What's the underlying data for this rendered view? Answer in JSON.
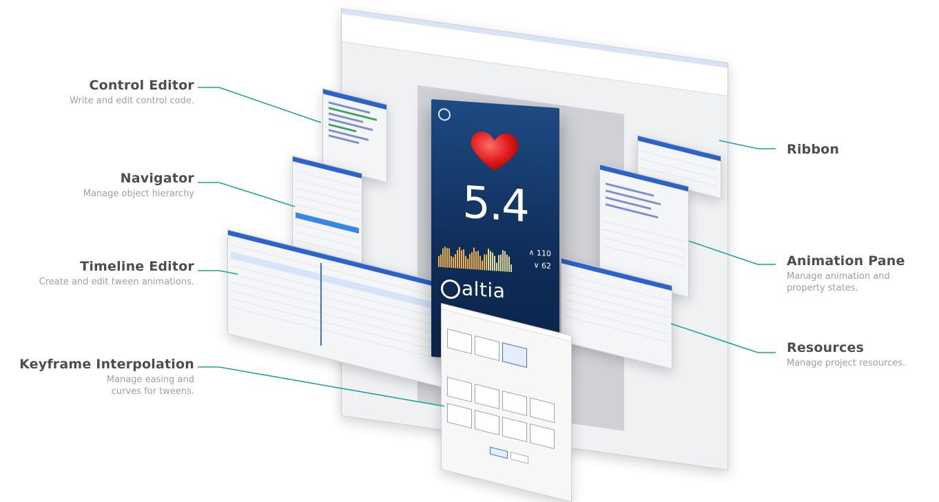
{
  "callouts": {
    "control_editor": {
      "title": "Control Editor",
      "desc": "Write and edit control code."
    },
    "navigator": {
      "title": "Navigator",
      "desc": "Manage object hierarchy"
    },
    "timeline_editor": {
      "title": "Timeline Editor",
      "desc": "Create and edit tween animations."
    },
    "keyframe_interpolation": {
      "title": "Keyframe Interpolation",
      "desc_line1": "Manage easing and",
      "desc_line2": "curves for tweens."
    },
    "ribbon": {
      "title": "Ribbon"
    },
    "animation_pane": {
      "title": "Animation Pane",
      "desc_line1": "Manage animation and",
      "desc_line2": "property states."
    },
    "resources": {
      "title": "Resources",
      "desc": "Manage project resources."
    }
  },
  "device": {
    "value": "5.4",
    "stat_high": "110",
    "stat_low": "62",
    "brand": "altia"
  },
  "colors": {
    "callout_line": "#1aa39a",
    "title_text": "#4a4d55",
    "desc_text": "#9b9ea6",
    "accent_blue": "#2c63c8"
  }
}
